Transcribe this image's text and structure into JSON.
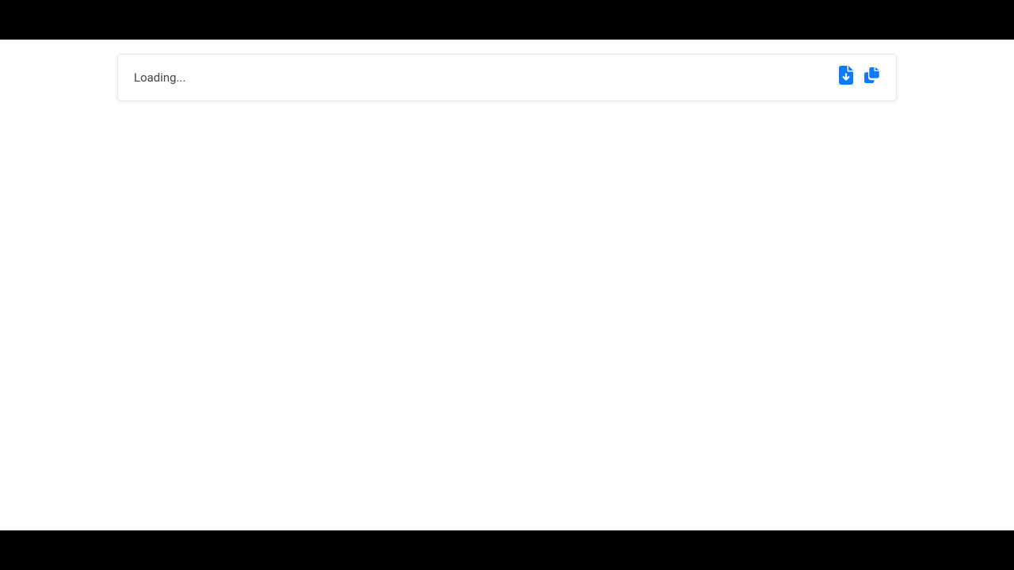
{
  "card": {
    "status_text": "Loading...",
    "actions": {
      "download_label": "download-file",
      "copy_label": "copy-file"
    }
  },
  "colors": {
    "accent": "#0d7bff",
    "bar": "#000000",
    "text": "#444444"
  }
}
